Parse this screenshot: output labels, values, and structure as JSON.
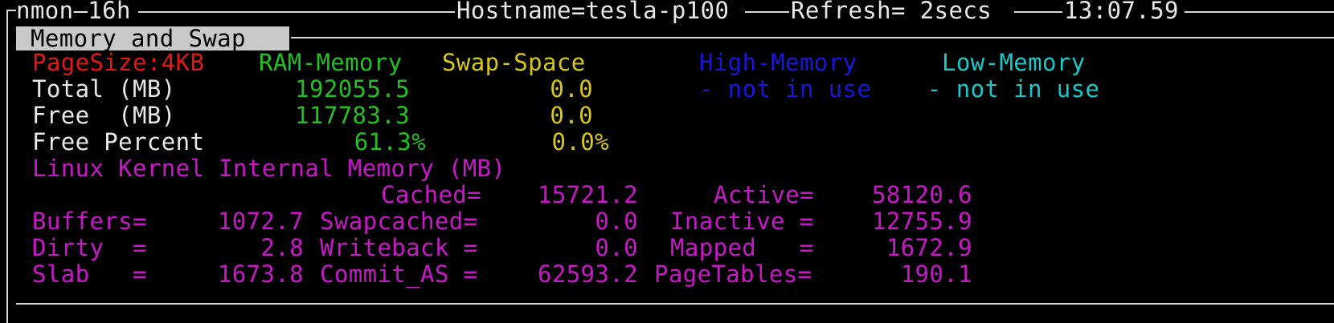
{
  "header": {
    "app": "nmon—16h",
    "hostname": "Hostname=tesla-p100",
    "refresh": "Refresh= 2secs",
    "time": "13:07.59"
  },
  "pane": {
    "title": "Memory and Swap"
  },
  "table": {
    "pagesize": "PageSize:4KB",
    "col_ram": "RAM-Memory",
    "col_swap": "Swap-Space",
    "col_high": "High-Memory",
    "col_low": "Low-Memory",
    "row_total": "Total (MB)",
    "row_free": "Free  (MB)",
    "row_freepct": "Free Percent",
    "ram_total": "192055.5",
    "ram_free": "117783.3",
    "ram_freepct": "61.3%",
    "swap_total": "0.0",
    "swap_free": "0.0",
    "swap_freepct": "0.0%",
    "high_status": "- not in use",
    "low_status": "- not in use"
  },
  "kernel": {
    "title": "Linux Kernel Internal Memory (MB)",
    "cached_label": "Cached=",
    "cached_value": "15721.2",
    "active_label": "Active=",
    "active_value": "58120.6",
    "buffers_label": "Buffers=",
    "buffers_value": "1072.7",
    "swapcached_label": "Swapcached=",
    "swapcached_value": "0.0",
    "inactive_label": "Inactive =",
    "inactive_value": "12755.9",
    "dirty_label": "Dirty  =",
    "dirty_value": "2.8",
    "writeback_label": "Writeback =",
    "writeback_value": "0.0",
    "mapped_label": "Mapped   =",
    "mapped_value": "1672.9",
    "slab_label": "Slab   =",
    "slab_value": "1673.8",
    "commit_label": "Commit_AS =",
    "commit_value": "62593.2",
    "pagetables_label": "PageTables=",
    "pagetables_value": "190.1"
  },
  "colors": {
    "background": "#000000",
    "foreground": "#e8e8e8",
    "red": "#e01818",
    "green": "#22c022",
    "yellow": "#d6c81a",
    "blue": "#1818d8",
    "cyan": "#18c8c8",
    "magenta": "#c818c8",
    "tab_bg": "#c9c9c9"
  }
}
